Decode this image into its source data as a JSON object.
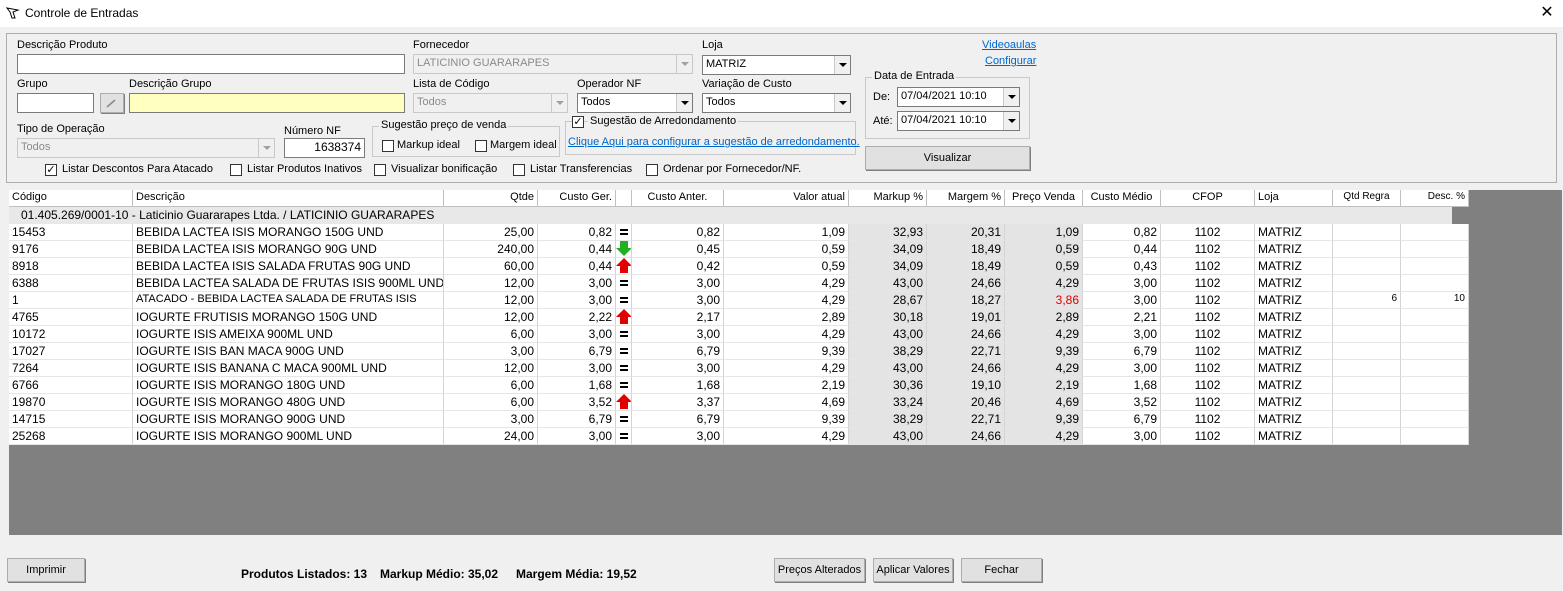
{
  "window": {
    "title": "Controle de Entradas",
    "close": "✕"
  },
  "filters": {
    "descricao_produto": {
      "label": "Descrição Produto",
      "value": ""
    },
    "fornecedor": {
      "label": "Fornecedor",
      "value": "LATICINIO GUARARAPES"
    },
    "loja": {
      "label": "Loja",
      "value": "MATRIZ"
    },
    "grupo": {
      "label": "Grupo",
      "value": ""
    },
    "descricao_grupo": {
      "label": "Descrição Grupo",
      "value": ""
    },
    "lista_codigo": {
      "label": "Lista de Código",
      "value": "Todos"
    },
    "operador_nf": {
      "label": "Operador NF",
      "value": "Todos"
    },
    "variacao_custo": {
      "label": "Variação de Custo",
      "value": "Todos"
    },
    "tipo_operacao": {
      "label": "Tipo de Operação",
      "value": "Todos"
    },
    "numero_nf": {
      "label": "Número NF",
      "value": "1638374"
    },
    "sugestao_preco": {
      "title": "Sugestão preço de venda",
      "markup": "Markup ideal",
      "margem": "Margem ideal"
    },
    "sugestao_arredondamento": {
      "label": "Sugestão de Arredondamento",
      "link": "Clique Aqui para configurar a sugestão de arredondamento."
    },
    "data_entrada": {
      "title": "Data de Entrada",
      "de_label": "De:",
      "de_value": "07/04/2021 10:10",
      "ate_label": "Até:",
      "ate_value": "07/04/2021 10:10"
    },
    "videoaulas": "Videoaulas",
    "configurar": "Configurar",
    "visualizar": "Visualizar",
    "checks": {
      "descontos_atacado": "Listar Descontos Para Atacado",
      "produtos_inativos": "Listar Produtos Inativos",
      "bonificacao": "Visualizar bonificação",
      "transferencias": "Listar Transferencias",
      "ordenar": "Ordenar por Fornecedor/NF."
    }
  },
  "grid": {
    "headers": [
      "Código",
      "Descrição",
      "Qtde",
      "Custo Ger.",
      "",
      "Custo Anter.",
      "Valor atual",
      "Markup %",
      "Margem %",
      "Preço Venda",
      "Custo Médio",
      "CFOP",
      "Loja",
      "Qtd Regra",
      "Desc. %"
    ],
    "group_label": "01.405.269/0001-10  -  Laticinio Guararapes Ltda. / LATICINIO GUARARAPES",
    "rows": [
      {
        "codigo": "15453",
        "descricao": "BEBIDA LACTEA ISIS MORANGO 150G UND",
        "qtde": "25,00",
        "custo_ger": "0,82",
        "ind": "eq",
        "custo_ant": "0,82",
        "valor": "1,09",
        "markup": "32,93",
        "margem": "20,31",
        "preco": "1,09",
        "medio": "0,82",
        "cfop": "1102",
        "loja": "MATRIZ",
        "regra": "",
        "desc": ""
      },
      {
        "codigo": "9176",
        "descricao": "BEBIDA LACTEA ISIS MORANGO 90G UND",
        "qtde": "240,00",
        "custo_ger": "0,44",
        "ind": "down",
        "custo_ant": "0,45",
        "valor": "0,59",
        "markup": "34,09",
        "margem": "18,49",
        "preco": "0,59",
        "medio": "0,44",
        "cfop": "1102",
        "loja": "MATRIZ",
        "regra": "",
        "desc": ""
      },
      {
        "codigo": "8918",
        "descricao": "BEBIDA LACTEA ISIS SALADA FRUTAS 90G UND",
        "qtde": "60,00",
        "custo_ger": "0,44",
        "ind": "up",
        "custo_ant": "0,42",
        "valor": "0,59",
        "markup": "34,09",
        "margem": "18,49",
        "preco": "0,59",
        "medio": "0,43",
        "cfop": "1102",
        "loja": "MATRIZ",
        "regra": "",
        "desc": ""
      },
      {
        "codigo": "6388",
        "descricao": "BEBIDA LACTEA SALADA DE FRUTAS ISIS 900ML UND",
        "qtde": "12,00",
        "custo_ger": "3,00",
        "ind": "eq",
        "custo_ant": "3,00",
        "valor": "4,29",
        "markup": "43,00",
        "margem": "24,66",
        "preco": "4,29",
        "medio": "3,00",
        "cfop": "1102",
        "loja": "MATRIZ",
        "regra": "",
        "desc": ""
      },
      {
        "codigo": "1",
        "descricao": "ATACADO - BEBIDA LACTEA SALADA DE FRUTAS ISIS",
        "qtde": "12,00",
        "custo_ger": "3,00",
        "ind": "eq",
        "custo_ant": "3,00",
        "valor": "4,29",
        "markup": "28,67",
        "margem": "18,27",
        "preco": "3,86",
        "medio": "3,00",
        "cfop": "1102",
        "loja": "MATRIZ",
        "regra": "6",
        "desc": "10",
        "red": true,
        "small": true
      },
      {
        "codigo": "4765",
        "descricao": "IOGURTE FRUTISIS MORANGO 150G UND",
        "qtde": "12,00",
        "custo_ger": "2,22",
        "ind": "up",
        "custo_ant": "2,17",
        "valor": "2,89",
        "markup": "30,18",
        "margem": "19,01",
        "preco": "2,89",
        "medio": "2,21",
        "cfop": "1102",
        "loja": "MATRIZ",
        "regra": "",
        "desc": ""
      },
      {
        "codigo": "10172",
        "descricao": "IOGURTE ISIS AMEIXA 900ML UND",
        "qtde": "6,00",
        "custo_ger": "3,00",
        "ind": "eq",
        "custo_ant": "3,00",
        "valor": "4,29",
        "markup": "43,00",
        "margem": "24,66",
        "preco": "4,29",
        "medio": "3,00",
        "cfop": "1102",
        "loja": "MATRIZ",
        "regra": "",
        "desc": ""
      },
      {
        "codigo": "17027",
        "descricao": "IOGURTE ISIS BAN MACA 900G UND",
        "qtde": "3,00",
        "custo_ger": "6,79",
        "ind": "eq",
        "custo_ant": "6,79",
        "valor": "9,39",
        "markup": "38,29",
        "margem": "22,71",
        "preco": "9,39",
        "medio": "6,79",
        "cfop": "1102",
        "loja": "MATRIZ",
        "regra": "",
        "desc": ""
      },
      {
        "codigo": "7264",
        "descricao": "IOGURTE ISIS BANANA C  MACA 900ML UND",
        "qtde": "12,00",
        "custo_ger": "3,00",
        "ind": "eq",
        "custo_ant": "3,00",
        "valor": "4,29",
        "markup": "43,00",
        "margem": "24,66",
        "preco": "4,29",
        "medio": "3,00",
        "cfop": "1102",
        "loja": "MATRIZ",
        "regra": "",
        "desc": ""
      },
      {
        "codigo": "6766",
        "descricao": "IOGURTE ISIS MORANGO 180G UND",
        "qtde": "6,00",
        "custo_ger": "1,68",
        "ind": "eq",
        "custo_ant": "1,68",
        "valor": "2,19",
        "markup": "30,36",
        "margem": "19,10",
        "preco": "2,19",
        "medio": "1,68",
        "cfop": "1102",
        "loja": "MATRIZ",
        "regra": "",
        "desc": ""
      },
      {
        "codigo": "19870",
        "descricao": "IOGURTE ISIS MORANGO 480G UND",
        "qtde": "6,00",
        "custo_ger": "3,52",
        "ind": "up",
        "custo_ant": "3,37",
        "valor": "4,69",
        "markup": "33,24",
        "margem": "20,46",
        "preco": "4,69",
        "medio": "3,52",
        "cfop": "1102",
        "loja": "MATRIZ",
        "regra": "",
        "desc": ""
      },
      {
        "codigo": "14715",
        "descricao": "IOGURTE ISIS MORANGO 900G UND",
        "qtde": "3,00",
        "custo_ger": "6,79",
        "ind": "eq",
        "custo_ant": "6,79",
        "valor": "9,39",
        "markup": "38,29",
        "margem": "22,71",
        "preco": "9,39",
        "medio": "6,79",
        "cfop": "1102",
        "loja": "MATRIZ",
        "regra": "",
        "desc": ""
      },
      {
        "codigo": "25268",
        "descricao": "IOGURTE ISIS MORANGO 900ML UND",
        "qtde": "24,00",
        "custo_ger": "3,00",
        "ind": "eq",
        "custo_ant": "3,00",
        "valor": "4,29",
        "markup": "43,00",
        "margem": "24,66",
        "preco": "4,29",
        "medio": "3,00",
        "cfop": "1102",
        "loja": "MATRIZ",
        "regra": "",
        "desc": ""
      }
    ]
  },
  "footer": {
    "imprimir": "Imprimir",
    "produtos_listados": "Produtos Listados: 13",
    "markup_medio": "Markup Médio: 35,02",
    "margem_media": "Margem Média: 19,52",
    "precos_alterados": "Preços Alterados",
    "aplicar_valores": "Aplicar Valores",
    "fechar": "Fechar"
  },
  "colors": {
    "price_alert": "#e00000",
    "arrow_up": "#e00000",
    "arrow_down": "#20b020",
    "grid_background": "#808080",
    "highlight_field": "#ffffc0"
  }
}
